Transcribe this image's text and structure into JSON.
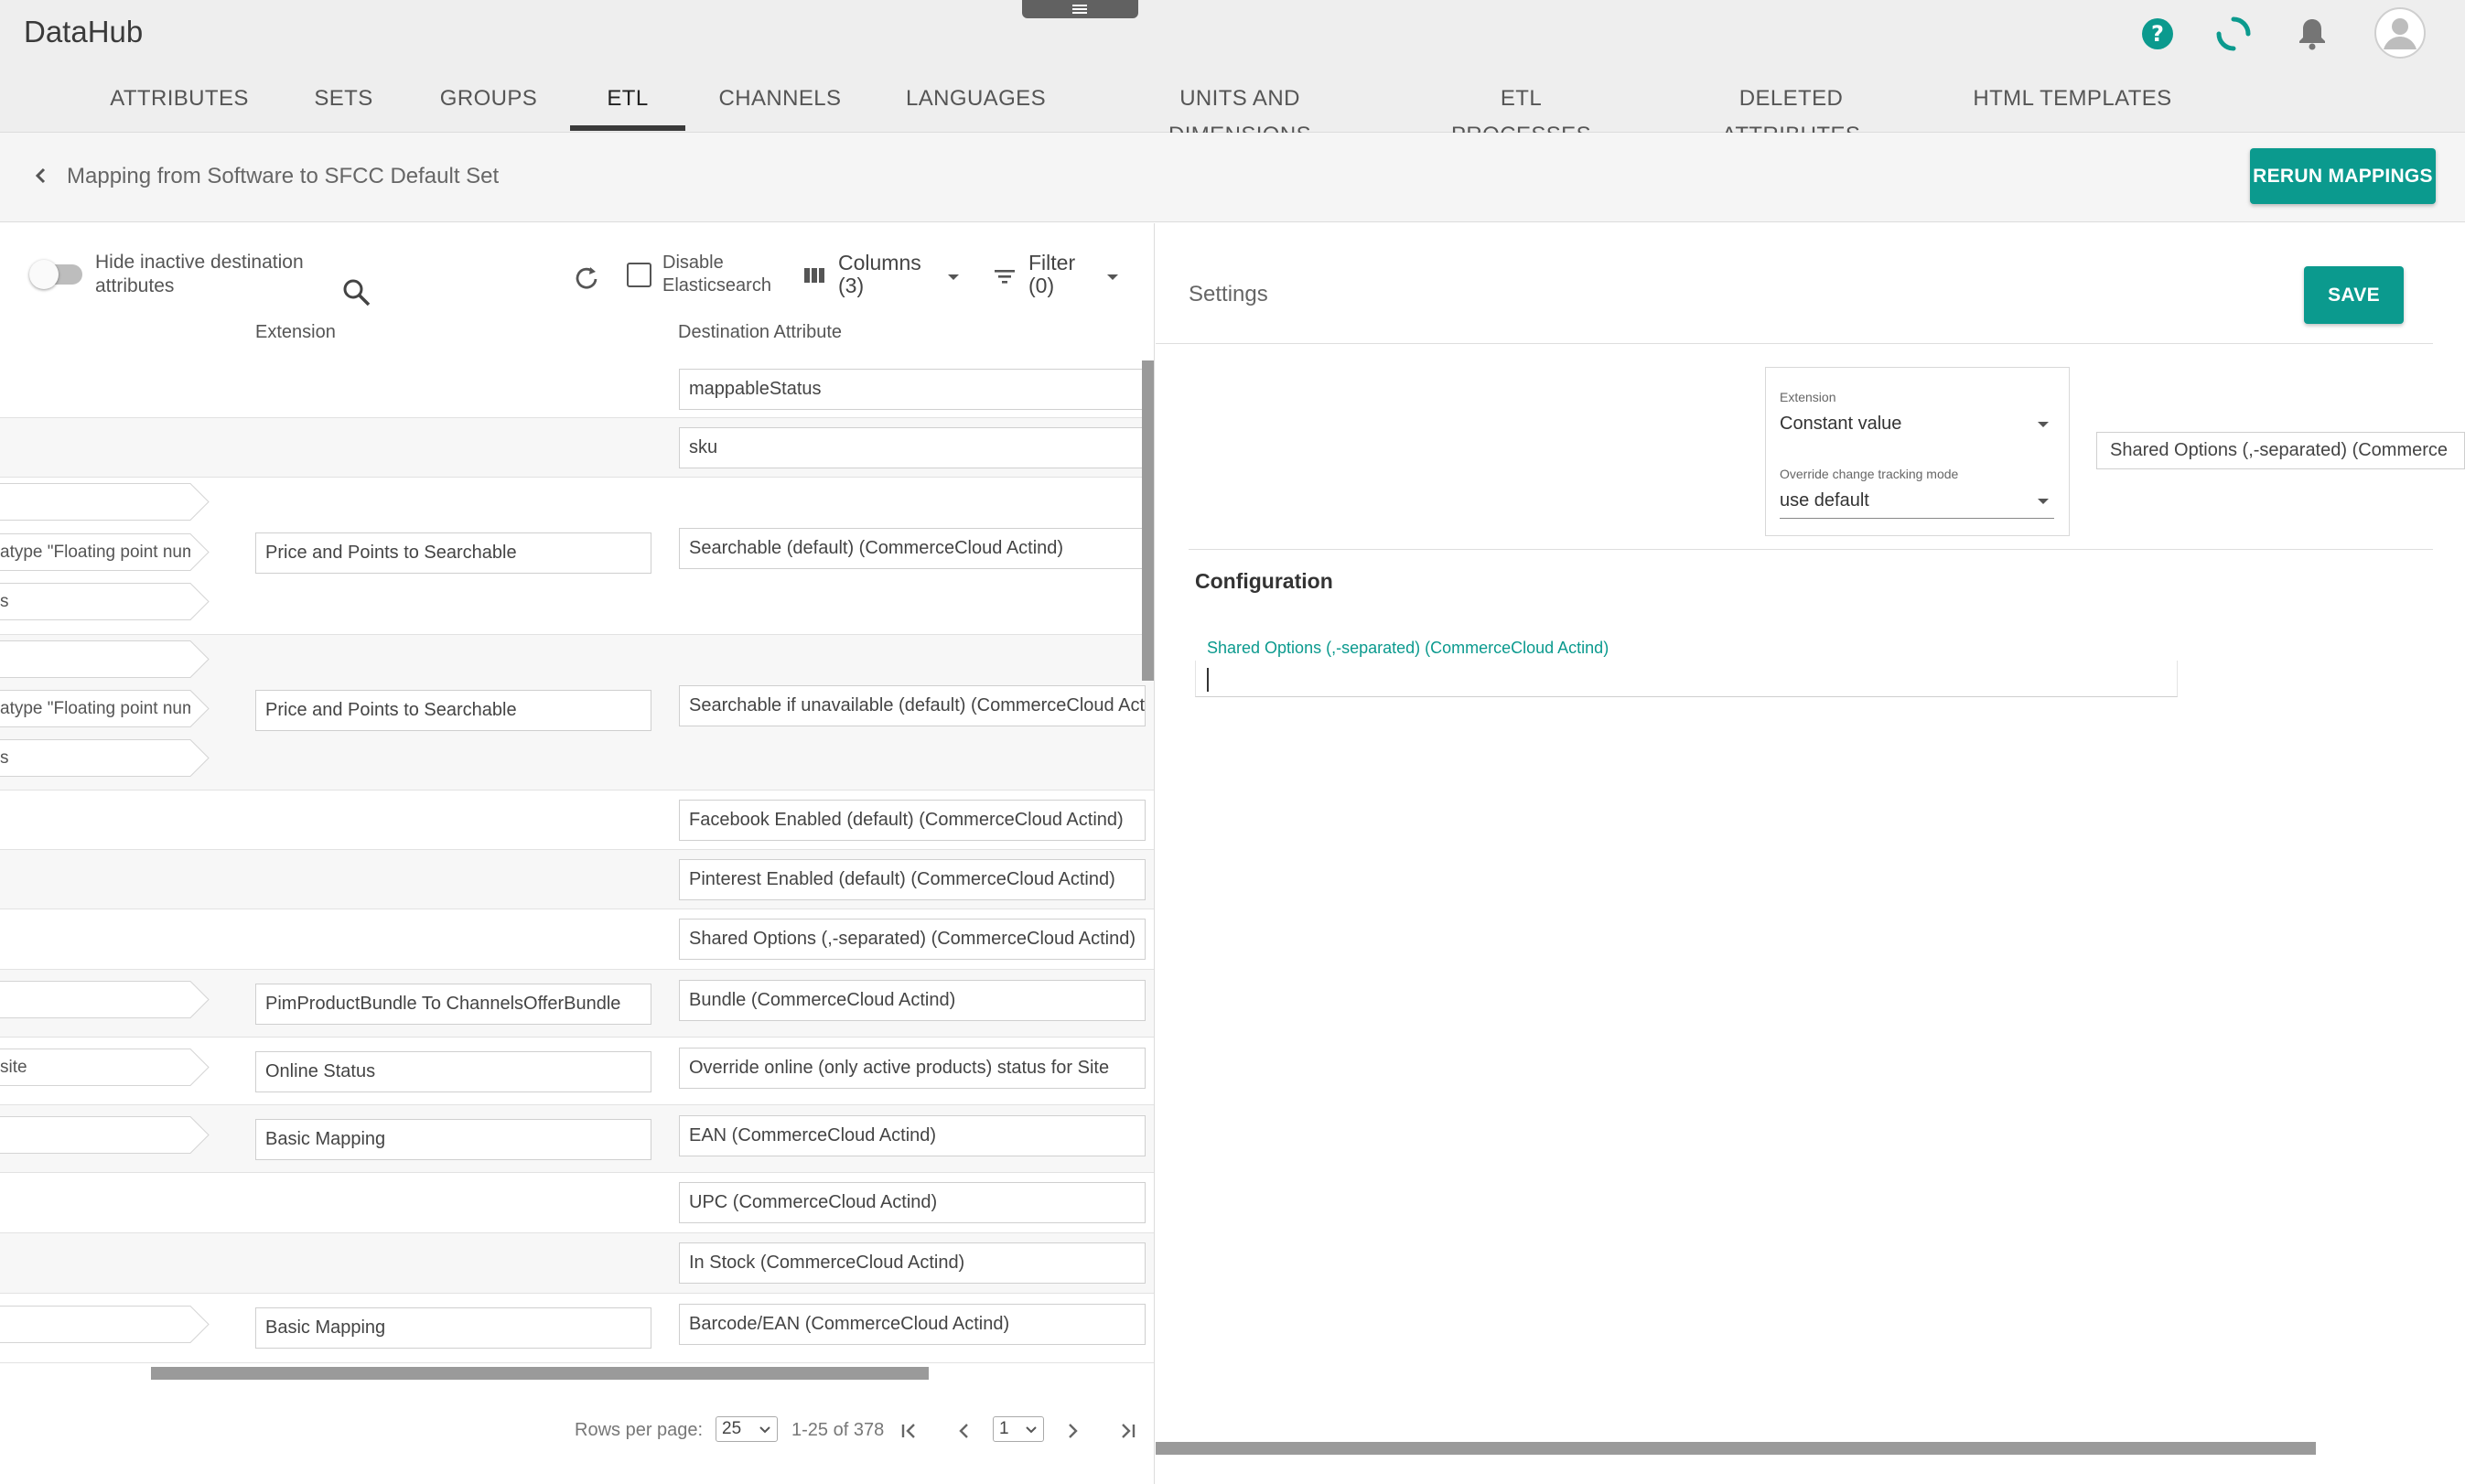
{
  "app": {
    "title": "DataHub"
  },
  "header_icons": [
    "help-icon",
    "loading-spinner-icon",
    "notifications-bell-icon",
    "user-avatar-icon"
  ],
  "colors": {
    "accent": "#0b9a8e",
    "header_bg": "#eeeeee",
    "tab_indicator": "#3a3a3a"
  },
  "tabs": [
    {
      "label": "ATTRIBUTES"
    },
    {
      "label": "SETS"
    },
    {
      "label": "GROUPS"
    },
    {
      "label": "ETL"
    },
    {
      "label": "CHANNELS"
    },
    {
      "label": "LANGUAGES"
    },
    {
      "label": "UNITS AND DIMENSIONS"
    },
    {
      "label": "ETL PROCESSES"
    },
    {
      "label": "DELETED ATTRIBUTES"
    },
    {
      "label": "HTML TEMPLATES"
    }
  ],
  "active_tab": "ETL",
  "breadcrumb": {
    "title": "Mapping from Software to SFCC Default Set",
    "rerun_label": "RERUN MAPPINGS"
  },
  "toolbar": {
    "toggle_label_line1": "Hide inactive destination",
    "toggle_label_line2": "attributes",
    "hide_inactive_checked": false,
    "disable_es_line1": "Disable",
    "disable_es_line2": "Elasticsearch",
    "disable_es_checked": false,
    "columns_line1": "Columns",
    "columns_line2": "(3)",
    "filter_line1": "Filter",
    "filter_line2": "(0)"
  },
  "table": {
    "columns": [
      "Extension",
      "Destination Attribute"
    ],
    "rows": [
      {
        "source": [],
        "extension": "",
        "destination": "mappableStatus"
      },
      {
        "source": [],
        "extension": "",
        "destination": "sku"
      },
      {
        "source": [
          "",
          "atype \"Floating point num",
          "s"
        ],
        "extension": "Price and Points to Searchable",
        "destination": "Searchable (default) (CommerceCloud Actind)"
      },
      {
        "source": [
          "",
          "atype \"Floating point num",
          "s"
        ],
        "extension": "Price and Points to Searchable",
        "destination": "Searchable if unavailable (default) (CommerceCloud Actin"
      },
      {
        "source": [],
        "extension": "",
        "destination": "Facebook Enabled (default) (CommerceCloud Actind)"
      },
      {
        "source": [],
        "extension": "",
        "destination": "Pinterest Enabled (default) (CommerceCloud Actind)"
      },
      {
        "source": [],
        "extension": "",
        "destination": "Shared Options (,-separated) (CommerceCloud Actind)"
      },
      {
        "source": [
          ""
        ],
        "extension": "PimProductBundle To ChannelsOfferBundle",
        "destination": "Bundle (CommerceCloud Actind)"
      },
      {
        "source": [
          "site"
        ],
        "extension": "Online Status",
        "destination": "Override online (only active products) status for Site"
      },
      {
        "source": [
          ""
        ],
        "extension": "Basic Mapping",
        "destination": "EAN (CommerceCloud Actind)"
      },
      {
        "source": [],
        "extension": "",
        "destination": "UPC (CommerceCloud Actind)"
      },
      {
        "source": [],
        "extension": "",
        "destination": "In Stock (CommerceCloud Actind)"
      },
      {
        "source": [
          ""
        ],
        "extension": "Basic Mapping",
        "destination": "Barcode/EAN (CommerceCloud Actind)"
      }
    ]
  },
  "pagination": {
    "rows_per_page_label": "Rows per page:",
    "rows_per_page": "25",
    "range": "1-25 of 378",
    "page": "1"
  },
  "settings": {
    "title": "Settings",
    "save_label": "SAVE",
    "extension_label": "Extension",
    "extension_value": "Constant value",
    "tracking_label": "Override change tracking mode",
    "tracking_value": "use default",
    "destination_attribute": "Shared Options (,-separated) (Commerce",
    "configuration_title": "Configuration",
    "config_field_label": "Shared Options (,-separated) (CommerceCloud Actind)",
    "config_field_value": ""
  }
}
